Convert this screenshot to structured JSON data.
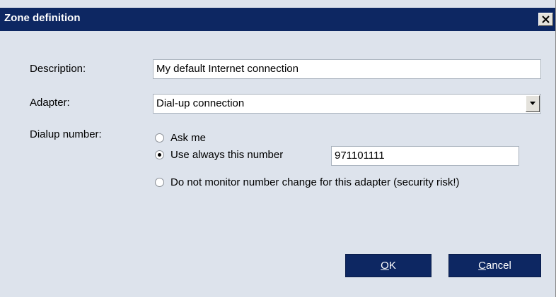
{
  "window": {
    "title": "Zone definition",
    "close_icon": "close-icon"
  },
  "form": {
    "description_label": "Description:",
    "description_value": "My default Internet connection",
    "adapter_label": "Adapter:",
    "adapter_value": "Dial-up connection",
    "dialup_label": "Dialup number:",
    "options": [
      {
        "label": "Ask me",
        "checked": false
      },
      {
        "label": "Use always this number",
        "checked": true
      },
      {
        "label": "Do not monitor number change for this adapter (security risk!)",
        "checked": false
      }
    ],
    "number_value": "971101111"
  },
  "buttons": {
    "ok_mnemonic": "O",
    "ok_rest": "K",
    "cancel_mnemonic": "C",
    "cancel_rest": "ancel"
  },
  "colors": {
    "titlebar": "#0d2762",
    "dialog_bg": "#dde3ec",
    "button_bg": "#0d2762"
  }
}
